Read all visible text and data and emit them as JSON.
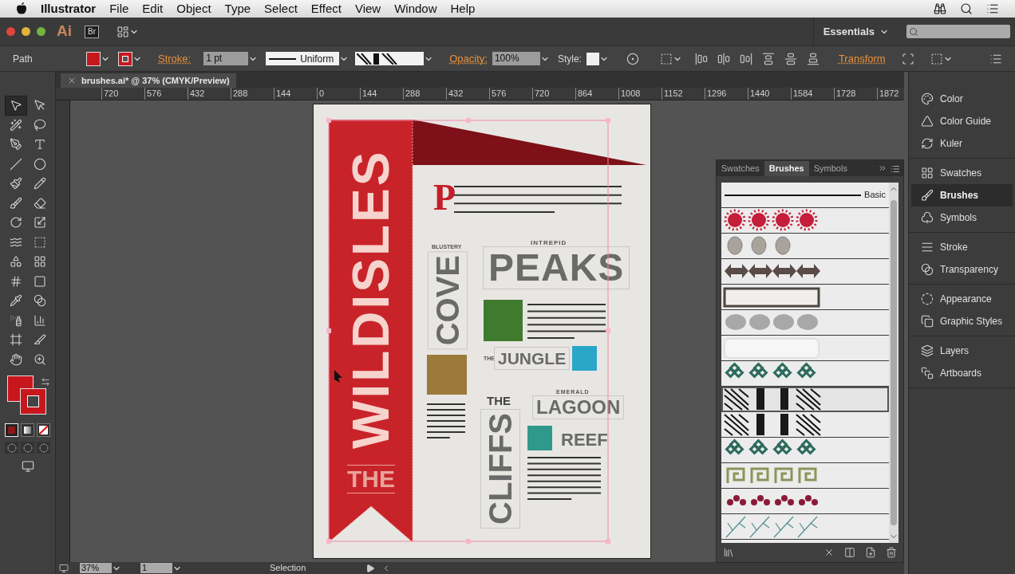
{
  "menubar": {
    "app": "Illustrator",
    "menus": [
      "File",
      "Edit",
      "Object",
      "Type",
      "Select",
      "Effect",
      "View",
      "Window",
      "Help"
    ]
  },
  "appbar": {
    "logo": "Ai",
    "bridge": "Br",
    "workspace": "Essentials"
  },
  "control_bar": {
    "selection": "Path",
    "stroke_label": "Stroke:",
    "stroke_weight": "1 pt",
    "profile": "Uniform",
    "opacity_label": "Opacity:",
    "opacity": "100%",
    "style_label": "Style:",
    "transform": "Transform"
  },
  "document_tab": {
    "title": "brushes.ai* @ 37% (CMYK/Preview)"
  },
  "ruler": [
    "720",
    "576",
    "432",
    "288",
    "144",
    "0",
    "144",
    "288",
    "432",
    "576",
    "720",
    "864",
    "1008",
    "1152",
    "1296",
    "1440",
    "1584",
    "1728",
    "1872"
  ],
  "tools": [
    {
      "kind": "selection",
      "selected": true
    },
    {
      "kind": "direct-selection",
      "selected": false
    },
    {
      "kind": "magic-wand",
      "selected": false
    },
    {
      "kind": "lasso",
      "selected": false
    },
    {
      "kind": "pen",
      "selected": false
    },
    {
      "kind": "type",
      "selected": false
    },
    {
      "kind": "line",
      "selected": false
    },
    {
      "kind": "ellipse",
      "selected": false
    },
    {
      "kind": "paintbrush",
      "selected": false
    },
    {
      "kind": "pencil",
      "selected": false
    },
    {
      "kind": "blob-brush",
      "selected": false
    },
    {
      "kind": "eraser",
      "selected": false
    },
    {
      "kind": "rotate",
      "selected": false
    },
    {
      "kind": "scale",
      "selected": false
    },
    {
      "kind": "warp",
      "selected": false
    },
    {
      "kind": "free-transform",
      "selected": false
    },
    {
      "kind": "shape-builder",
      "selected": false
    },
    {
      "kind": "perspective-grid",
      "selected": false
    },
    {
      "kind": "mesh",
      "selected": false
    },
    {
      "kind": "gradient",
      "selected": false
    },
    {
      "kind": "eyedropper",
      "selected": false
    },
    {
      "kind": "blend",
      "selected": false
    },
    {
      "kind": "symbol-sprayer",
      "selected": false
    },
    {
      "kind": "column-graph",
      "selected": false
    },
    {
      "kind": "artboard",
      "selected": false
    },
    {
      "kind": "slice",
      "selected": false
    },
    {
      "kind": "hand",
      "selected": false
    },
    {
      "kind": "zoom",
      "selected": false
    }
  ],
  "paint": [
    {
      "kind": "fill",
      "color": "#c8161d"
    },
    {
      "kind": "stroke",
      "color": "#c8161d"
    }
  ],
  "color_modes": [
    {
      "kind": "color",
      "selected": true
    },
    {
      "kind": "gradient",
      "selected": false
    },
    {
      "kind": "none",
      "selected": false
    }
  ],
  "poster": {
    "title_main": "WILDISLES",
    "title_the": "THE",
    "drop_cap": "P",
    "cove_kicker": "BLUSTERY",
    "cove": "COVE",
    "peaks_kicker": "INTREPID",
    "peaks": "PEAKS",
    "jungle_kicker": "THE",
    "jungle": "JUNGLE",
    "cliffs_kicker": "THE",
    "cliffs": "CLIFFS",
    "lagoon_kicker": "EMERALD",
    "lagoon": "LAGOON",
    "reef": "REEF"
  },
  "brushes_panel": {
    "tabs": [
      {
        "label": "Swatches",
        "selected": false
      },
      {
        "label": "Brushes",
        "selected": true
      },
      {
        "label": "Symbols",
        "selected": false
      }
    ],
    "brushes": [
      {
        "kind": "basic",
        "label": "Basic",
        "selected": false
      },
      {
        "kind": "splat",
        "selected": false
      },
      {
        "kind": "skull",
        "selected": false
      },
      {
        "kind": "arrow",
        "selected": false
      },
      {
        "kind": "frame",
        "selected": false
      },
      {
        "kind": "leaf",
        "selected": false
      },
      {
        "kind": "rough",
        "selected": false
      },
      {
        "kind": "knot",
        "selected": false
      },
      {
        "kind": "hatch",
        "selected": true
      },
      {
        "kind": "hatch",
        "selected": false
      },
      {
        "kind": "knot",
        "selected": false
      },
      {
        "kind": "key",
        "selected": false
      },
      {
        "kind": "scroll",
        "selected": false
      },
      {
        "kind": "branch",
        "selected": false
      }
    ]
  },
  "dock": [
    [
      {
        "label": "Color",
        "selected": false
      },
      {
        "label": "Color Guide",
        "selected": false
      },
      {
        "label": "Kuler",
        "selected": false
      }
    ],
    [
      {
        "label": "Swatches",
        "selected": false
      },
      {
        "label": "Brushes",
        "selected": true
      },
      {
        "label": "Symbols",
        "selected": false
      }
    ],
    [
      {
        "label": "Stroke",
        "selected": false
      },
      {
        "label": "Transparency",
        "selected": false
      }
    ],
    [
      {
        "label": "Appearance",
        "selected": false
      },
      {
        "label": "Graphic Styles",
        "selected": false
      }
    ],
    [
      {
        "label": "Layers",
        "selected": false
      },
      {
        "label": "Artboards",
        "selected": false
      }
    ]
  ],
  "status_bar": {
    "zoom": "37%",
    "artboard": "1",
    "tool": "Selection"
  }
}
